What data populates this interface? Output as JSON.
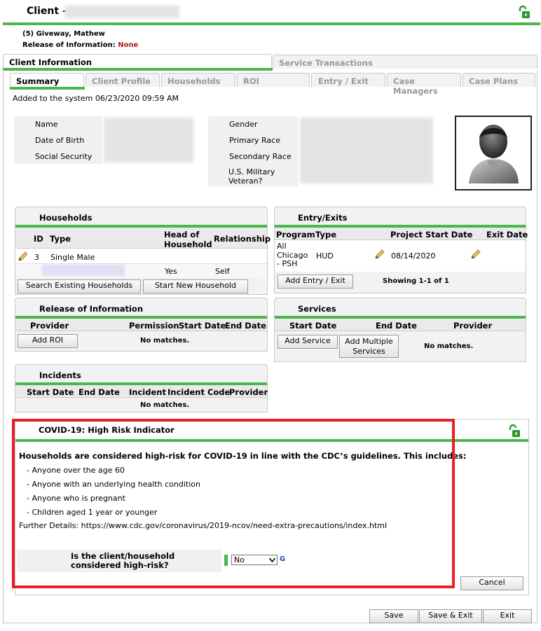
{
  "header": {
    "title": "Client -",
    "client_line": "(5) Giveway, Mathew",
    "roi_label": "Release of Information:",
    "roi_value": "None"
  },
  "top_tabs": [
    "Client Information",
    "Service Transactions"
  ],
  "sub_tabs": [
    "Summary",
    "Client Profile",
    "Households",
    "ROI",
    "Entry / Exit",
    "Case Managers",
    "Case Plans"
  ],
  "summary": {
    "added_text": "Added to the system 06/23/2020 09:59 AM",
    "left_fields": [
      "Name",
      "Date of Birth",
      "Social Security"
    ],
    "right_fields": [
      "Gender",
      "Primary Race",
      "Secondary Race",
      "U.S. Military Veteran?"
    ]
  },
  "households": {
    "title": "Households",
    "headers": [
      "ID",
      "Type",
      "Head of Household",
      "Relationship"
    ],
    "row": {
      "id": "3",
      "type": "Single Male"
    },
    "member": {
      "head": "Yes",
      "relationship": "Self"
    },
    "buttons": [
      "Search Existing Households",
      "Start New Household"
    ]
  },
  "entry_exits": {
    "title": "Entry/Exits",
    "headers": [
      "Program",
      "Type",
      "Project Start Date",
      "Exit Date"
    ],
    "row": {
      "program": "All Chicago - PSH",
      "type": "HUD",
      "start": "08/14/2020"
    },
    "add_button": "Add Entry / Exit",
    "showing": "Showing 1-1 of 1"
  },
  "roi_panel": {
    "title": "Release of Information",
    "headers": [
      "Provider",
      "Permission",
      "Start Date",
      "End Date"
    ],
    "add_button": "Add ROI",
    "empty": "No matches."
  },
  "services": {
    "title": "Services",
    "headers": [
      "Start Date",
      "End Date",
      "Provider"
    ],
    "add_button": "Add Service",
    "add_multi": "Add Multiple Services",
    "empty": "No matches."
  },
  "incidents": {
    "title": "Incidents",
    "headers": [
      "Start Date",
      "End Date",
      "Incident",
      "Incident Code",
      "Provider"
    ],
    "empty": "No matches."
  },
  "covid": {
    "title": "COVID-19: High Risk Indicator",
    "intro": "Households are considered high-risk for COVID-19 in line with the CDC’s guidelines. This includes:",
    "bullets": [
      "- Anyone over the age 60",
      "- Anyone with an underlying health condition",
      "- Anyone who is pregnant",
      "- Children aged 1 year or younger"
    ],
    "details": "Further Details: https://www.cdc.gov/coronavirus/2019-ncov/need-extra-precautions/index.html",
    "question": "Is the client/household considered high-risk?",
    "answer": "No",
    "g_link": "G",
    "cancel": "Cancel"
  },
  "footer_buttons": [
    "Save",
    "Save & Exit",
    "Exit"
  ],
  "colors": {
    "accent_green": "#4cb84c",
    "highlight_red": "#e8202a",
    "link_blue": "#1a44c8",
    "none_red": "#b01818"
  }
}
